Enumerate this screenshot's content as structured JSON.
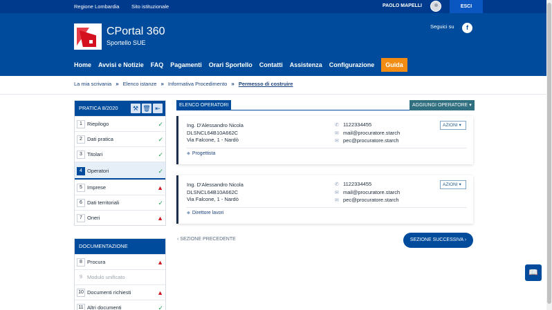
{
  "topbar": {
    "link1": "Regione Lombardia",
    "link2": "Sito istituzionale",
    "user": "PAOLO MAPELLI",
    "logout": "ESCI"
  },
  "header": {
    "title": "CPortal 360",
    "subtitle": "Sportello SUE",
    "social_label": "Seguici su",
    "social_icon": "f"
  },
  "nav": [
    "Home",
    "Avvisi e Notizie",
    "FAQ",
    "Pagamenti",
    "Orari Sportello",
    "Contatti",
    "Assistenza",
    "Configurazione",
    "Guida"
  ],
  "breadcrumb": [
    "La mia scrivania",
    "Elenco istanze",
    "Informativa Procedimento",
    "Permesso di costruire"
  ],
  "pratica": {
    "title": "PRATICA 8/2020",
    "steps": [
      {
        "num": "1",
        "label": "Riepilogo",
        "status": "ok"
      },
      {
        "num": "2",
        "label": "Dati pratica",
        "status": "ok"
      },
      {
        "num": "3",
        "label": "Titolari",
        "status": "ok"
      },
      {
        "num": "4",
        "label": "Operatori",
        "status": "ok"
      },
      {
        "num": "5",
        "label": "Imprese",
        "status": "warn"
      },
      {
        "num": "6",
        "label": "Dati territoriali",
        "status": "ok"
      },
      {
        "num": "7",
        "label": "Oneri",
        "status": "warn"
      }
    ]
  },
  "documentazione": {
    "title": "DOCUMENTAZIONE",
    "steps": [
      {
        "num": "8",
        "label": "Procura",
        "status": "warn"
      },
      {
        "num": "9",
        "label": "Modulo unificato",
        "status": "none"
      },
      {
        "num": "10",
        "label": "Documenti richiesti",
        "status": "warn"
      },
      {
        "num": "11",
        "label": "Altri documenti",
        "status": "ok"
      }
    ]
  },
  "main": {
    "section_title": "ELENCO OPERATORI",
    "add_button": "AGGIUNGI OPERATORE",
    "operators": [
      {
        "name": "Ing. D'Alessandro Nicola",
        "cf": "DLSNCL64B10A662C",
        "address": "Via Falcone, 1 - Nardò",
        "phone": "1122334455",
        "mail": "mail@procuratore.starch",
        "pec": "pec@procuratore.starch",
        "actions": "AZIONI",
        "role": "Progettista"
      },
      {
        "name": "Ing. D'Alessandro Nicola",
        "cf": "DLSNCL64B10A662C",
        "address": "Via Falcone, 1 - Nardò",
        "phone": "1122334455",
        "mail": "mail@procuratore.starch",
        "pec": "pec@procuratore.starch",
        "actions": "AZIONI",
        "role": "Direttore lavori"
      }
    ],
    "prev_label": "SEZIONE PRECEDENTE",
    "next_label": "SEZIONE SUCCESSIVA"
  },
  "icons": {
    "ok": "✓",
    "warn": "▲",
    "tool1": "⚒",
    "tool2": "🗑",
    "tool3": "⇤",
    "phone": "✆",
    "mail": "✉",
    "tag": "⬥",
    "book": "📖"
  }
}
